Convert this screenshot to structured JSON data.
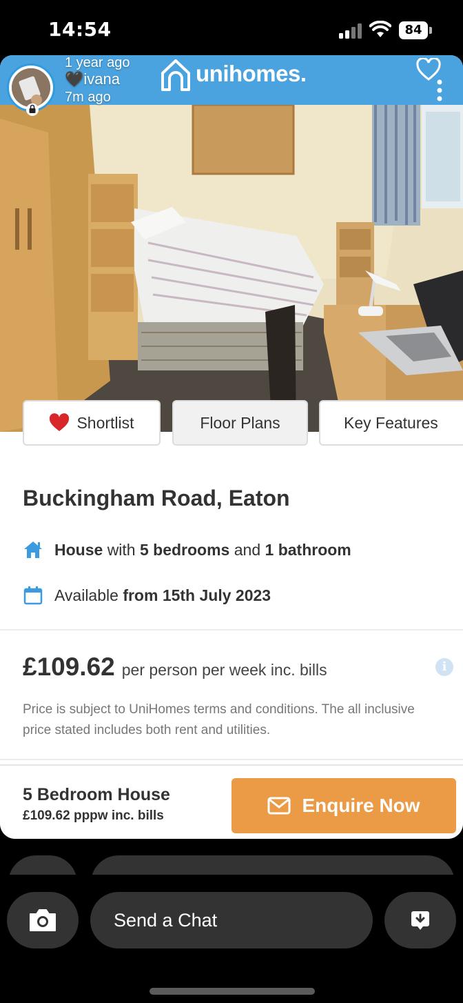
{
  "status_bar": {
    "time": "14:54",
    "battery": "84"
  },
  "snap": {
    "posted_ago": "1 year ago",
    "username": "ivana",
    "viewed_ago": "7m ago"
  },
  "app": {
    "logo_text": "unihomes."
  },
  "gallery": {
    "image_count": 7,
    "active_index": 3
  },
  "actions": {
    "shortlist_label": "Shortlist",
    "floor_plans_label": "Floor Plans",
    "key_features_label": "Key Features"
  },
  "property": {
    "title": "Buckingham Road, Eaton",
    "type": "House",
    "with_word": "with",
    "bedrooms": "5 bedrooms",
    "and_word": "and",
    "bathrooms": "1 bathroom",
    "available_prefix": "Available",
    "available_date": "from 15th July 2023"
  },
  "pricing": {
    "price": "£109.62",
    "price_suffix": "per person per week inc. bills",
    "disclaimer": "Price is subject to UniHomes terms and conditions. The all inclusive price stated includes both rent and utilities."
  },
  "footer": {
    "title": "5 Bedroom House",
    "subtitle": "£109.62 pppw inc. bills",
    "enquire_label": "Enquire Now"
  },
  "chat": {
    "placeholder": "Send a Chat"
  },
  "colors": {
    "header_blue": "#4aa3de",
    "enquire_orange": "#eb9a45",
    "icon_blue": "#3a9be0",
    "heart_red": "#d9262a"
  }
}
